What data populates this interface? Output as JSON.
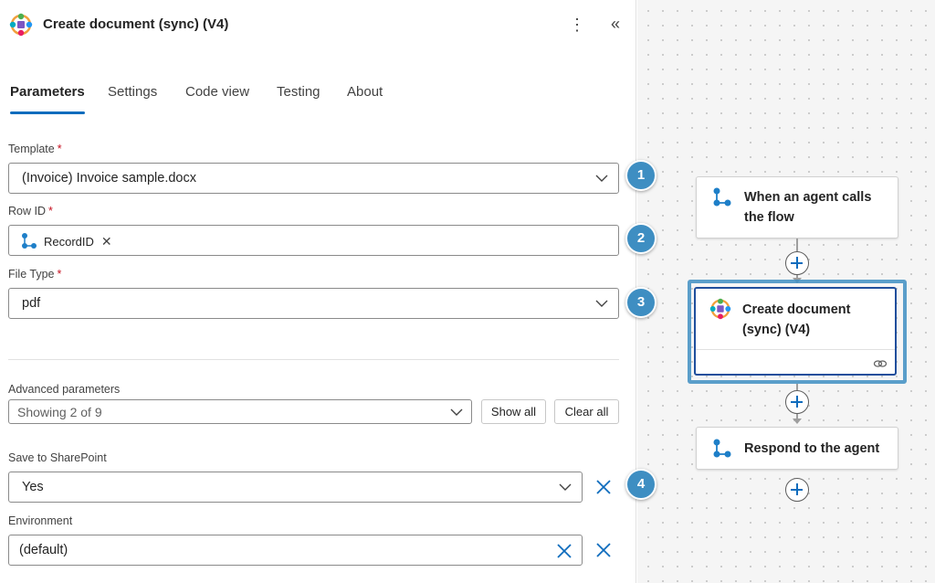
{
  "header": {
    "title": "Create document (sync) (V4)"
  },
  "tabs": [
    {
      "label": "Parameters",
      "active": true
    },
    {
      "label": "Settings"
    },
    {
      "label": "Code view"
    },
    {
      "label": "Testing"
    },
    {
      "label": "About"
    }
  ],
  "fields": {
    "template": {
      "label": "Template",
      "value": "(Invoice) Invoice sample.docx"
    },
    "row_id": {
      "label": "Row ID",
      "token": "RecordID",
      "token_remove": "✕"
    },
    "file_type": {
      "label": "File Type",
      "value": "pdf"
    },
    "required_mark": "*"
  },
  "advanced": {
    "label": "Advanced parameters",
    "value": "Showing 2 of 9",
    "show_all": "Show all",
    "clear_all": "Clear all"
  },
  "save_to_sharepoint": {
    "label": "Save to SharePoint",
    "value": "Yes"
  },
  "environment": {
    "label": "Environment",
    "value": "(default)"
  },
  "badges": [
    "1",
    "2",
    "3",
    "4"
  ],
  "flow": {
    "trigger": {
      "title_line1": "When an agent calls",
      "title_line2": "the flow"
    },
    "action": {
      "title_line1": "Create document",
      "title_line2": "(sync) (V4)"
    },
    "respond": {
      "title": "Respond to the agent"
    }
  },
  "colors": {
    "accent": "#0f6cbd",
    "badge": "#3e8ec2",
    "selected": "#1f4e9c"
  }
}
